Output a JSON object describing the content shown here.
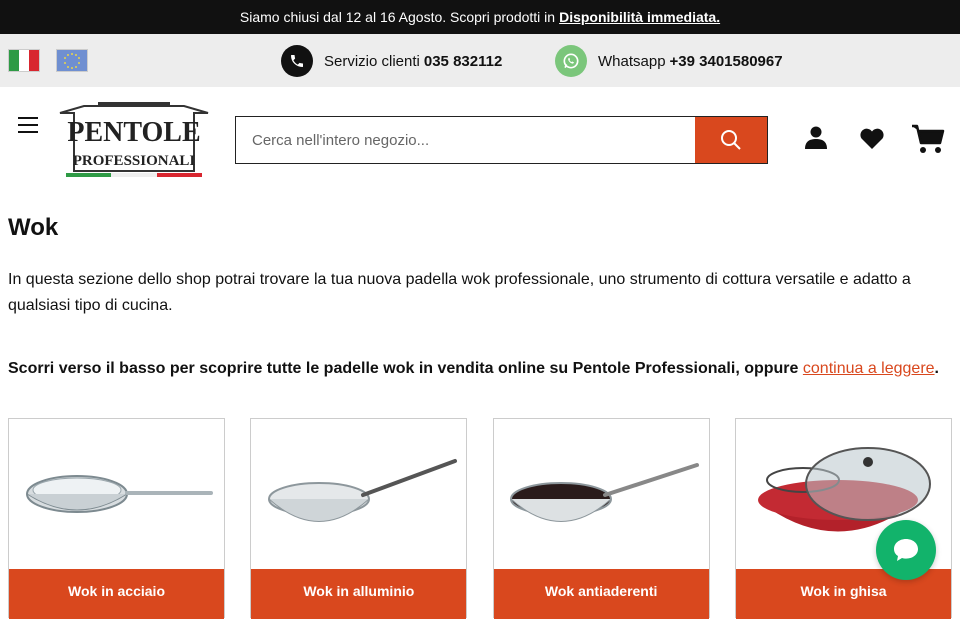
{
  "announcement": {
    "text": "Siamo chiusi dal 12 al 16 Agosto. Scopri prodotti in",
    "link": "Disponibilità immediata."
  },
  "infobar": {
    "phone_label": "Servizio clienti",
    "phone_number": "035 832112",
    "whatsapp_label": "Whatsapp",
    "whatsapp_number": "+39 3401580967"
  },
  "logo": {
    "line1": "PENTOLE",
    "line2": "PROFESSIONALI"
  },
  "search": {
    "placeholder": "Cerca nell'intero negozio..."
  },
  "page": {
    "title": "Wok",
    "intro": "In questa sezione dello shop potrai trovare la tua nuova padella wok professionale, uno strumento di cottura versatile e adatto a qualsiasi tipo di cucina.",
    "cta_text": "Scorri verso il basso per scoprire tutte le padelle wok in vendita online su Pentole Professionali, oppure",
    "cta_link": "continua a leggere",
    "cta_end": "."
  },
  "categories": [
    {
      "label": "Wok in acciaio"
    },
    {
      "label": "Wok in alluminio"
    },
    {
      "label": "Wok antiaderenti"
    },
    {
      "label": "Wok in ghisa"
    }
  ],
  "colors": {
    "accent": "#d9481e",
    "topbar": "#111111",
    "infobar": "#ededed",
    "chat": "#12b36b"
  }
}
